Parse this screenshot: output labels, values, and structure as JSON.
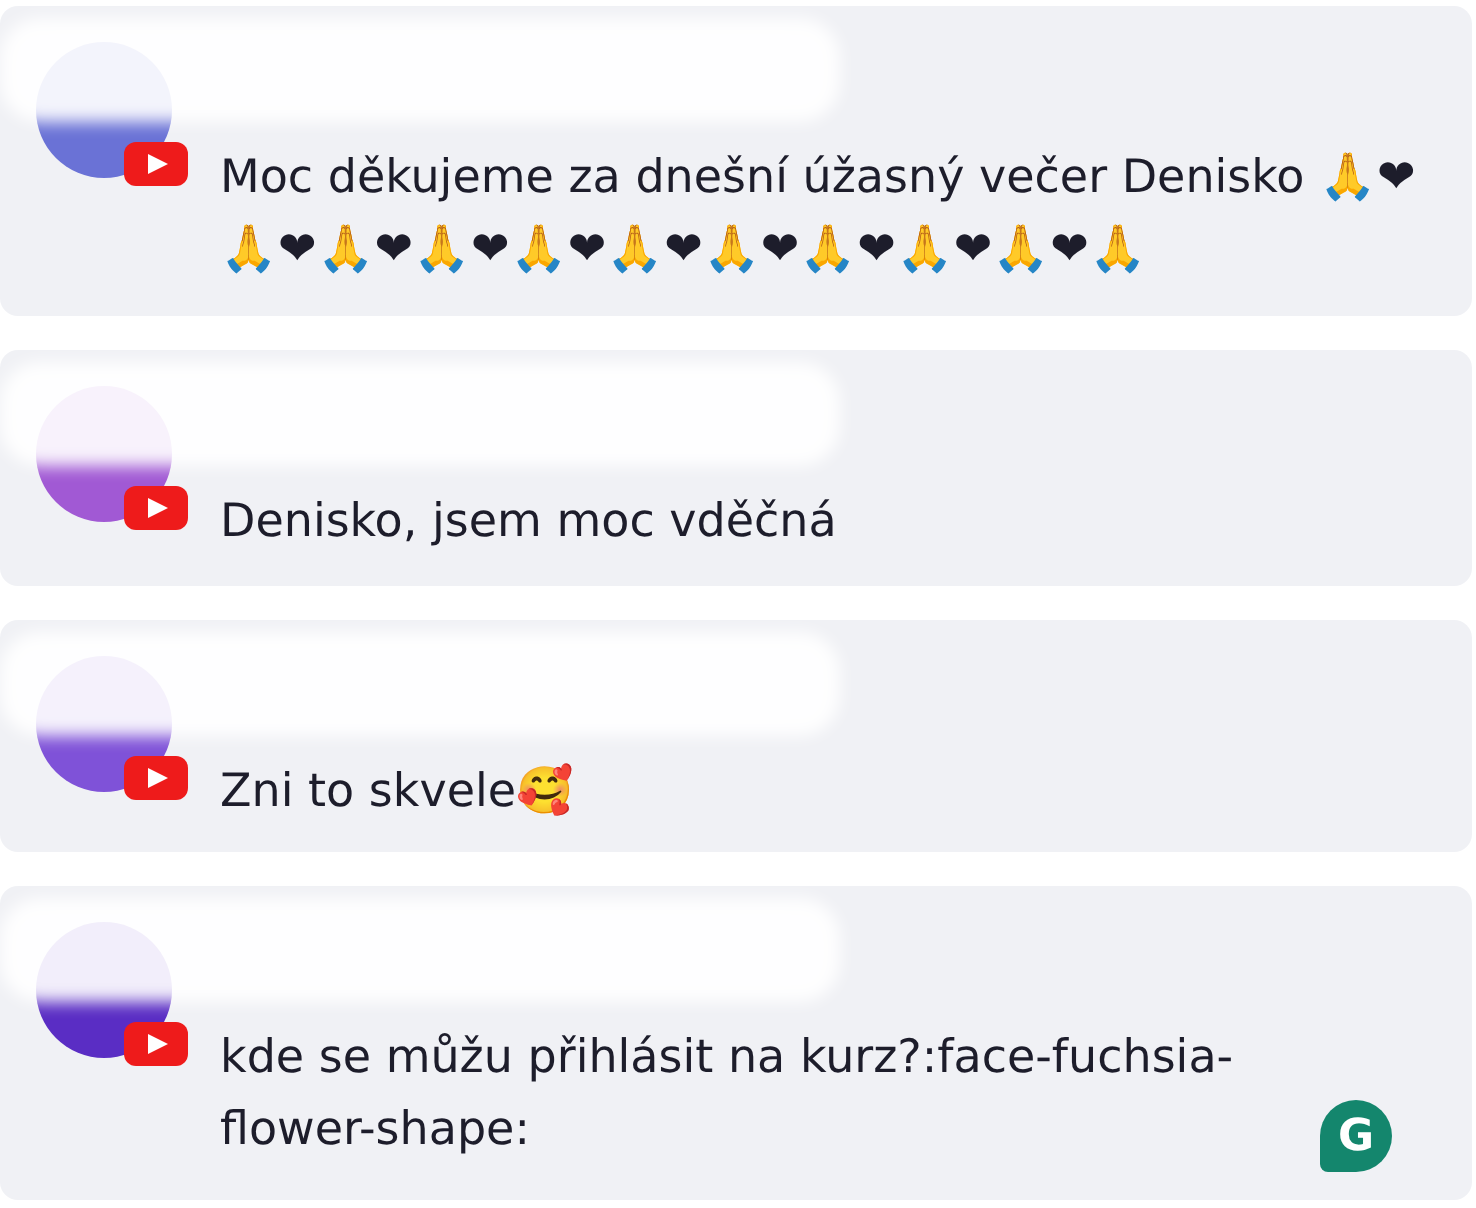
{
  "comments": [
    {
      "color": "#6a72d6",
      "text": "Moc děkujeme za dnešní úžasný večer Denisko 🙏❤🙏❤🙏❤🙏❤🙏❤🙏❤🙏❤🙏❤🙏❤🙏❤🙏"
    },
    {
      "color": "#a159d4",
      "text": "Denisko, jsem moc vděčná"
    },
    {
      "color": "#7f52d8",
      "text": "Zni to skvele🥰"
    },
    {
      "color": "#5a2dc4",
      "text": "kde se můžu přihlásit na kurz?:face-fuchsia-flower-shape:"
    }
  ],
  "grammarly_button": {
    "label": "G"
  }
}
